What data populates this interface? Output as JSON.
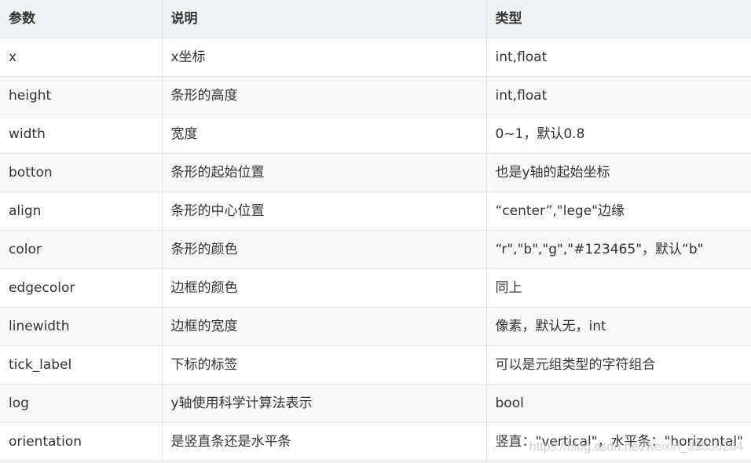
{
  "table": {
    "headers": [
      "参数",
      "说明",
      "类型"
    ],
    "rows": [
      [
        "x",
        "x坐标",
        "int,float"
      ],
      [
        "height",
        "条形的高度",
        "int,float"
      ],
      [
        "width",
        "宽度",
        "0~1，默认0.8"
      ],
      [
        "botton",
        "条形的起始位置",
        "也是y轴的起始坐标"
      ],
      [
        "align",
        "条形的中心位置",
        "“center”,\"lege\"边缘"
      ],
      [
        "color",
        "条形的颜色",
        "“r\",\"b\",\"g\",\"#123465\"，默认“b\""
      ],
      [
        "edgecolor",
        "边框的颜色",
        "同上"
      ],
      [
        "linewidth",
        "边框的宽度",
        "像素，默认无，int"
      ],
      [
        "tick_label",
        "下标的标签",
        "可以是元组类型的字符组合"
      ],
      [
        "log",
        "y轴使用科学计算法表示",
        "bool"
      ],
      [
        "orientation",
        "是竖直条还是水平条",
        "竖直：\"vertical\"，水平条：\"horizontal\""
      ]
    ]
  },
  "watermark": "https://blog.csdn.net/weixin_39550264",
  "colors": {
    "header_bg": "#eff3f5",
    "row_alt_bg": "#f8f8f8",
    "border": "#e4e4e4",
    "text": "#333333"
  }
}
